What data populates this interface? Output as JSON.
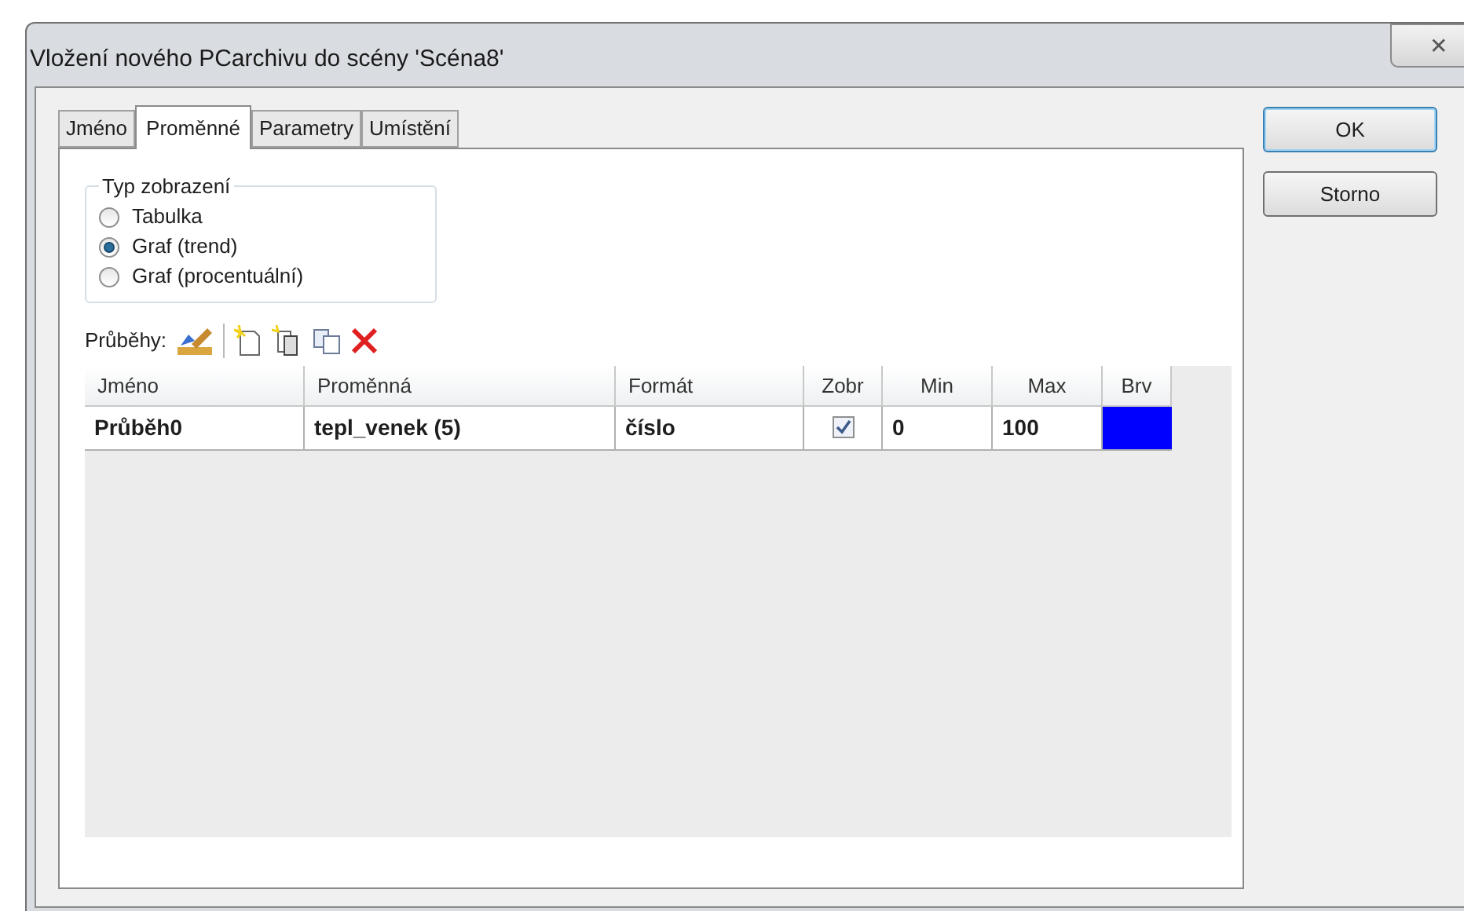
{
  "window": {
    "title": "Vložení nového PCarchivu do scény 'Scéna8'",
    "close": "✕"
  },
  "tabs": [
    {
      "label": "Jméno",
      "selected": false
    },
    {
      "label": "Proměnné",
      "selected": true
    },
    {
      "label": "Parametry",
      "selected": false
    },
    {
      "label": "Umístění",
      "selected": false
    }
  ],
  "display_type": {
    "legend": "Typ zobrazení",
    "options": [
      {
        "label": "Tabulka",
        "selected": false
      },
      {
        "label": "Graf (trend)",
        "selected": true
      },
      {
        "label": "Graf (procentuální)",
        "selected": false
      }
    ]
  },
  "traces": {
    "label": "Průběhy:"
  },
  "table": {
    "columns": [
      "Jméno",
      "Proměnná",
      "Formát",
      "Zobr",
      "Min",
      "Max",
      "Brv"
    ],
    "rows": [
      {
        "name": "Průběh0",
        "variable": "tepl_venek (5)",
        "format": "číslo",
        "shown": true,
        "min": "0",
        "max": "100",
        "color": "#0000ff"
      }
    ]
  },
  "buttons": [
    "OK",
    "Storno"
  ]
}
